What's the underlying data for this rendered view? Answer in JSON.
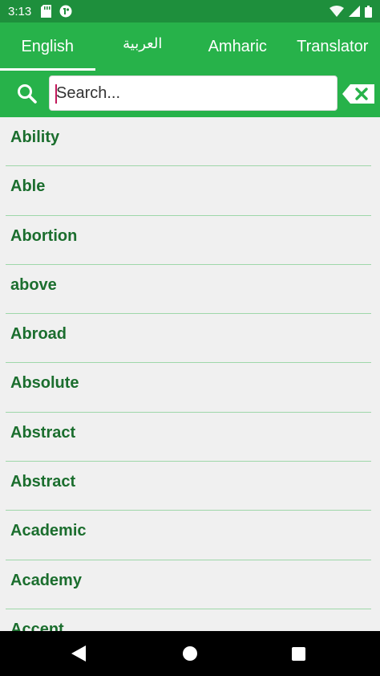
{
  "status_bar": {
    "time": "3:13",
    "left_icons": [
      "sd-card-icon",
      "app-notification-icon"
    ],
    "right_icons": [
      "wifi-icon",
      "signal-icon",
      "battery-icon"
    ]
  },
  "tabs": [
    {
      "label": "English",
      "selected": true
    },
    {
      "label": "العربية",
      "selected": false
    },
    {
      "label": "Amharic",
      "selected": false
    },
    {
      "label": "Translator",
      "selected": false
    }
  ],
  "search": {
    "placeholder": "Search...",
    "value": ""
  },
  "words": [
    "Ability",
    "Able",
    "Abortion",
    "above",
    "Abroad",
    "Absolute",
    "Abstract",
    "Abstract",
    "Academic",
    "Academy",
    "Accent"
  ],
  "colors": {
    "status_bar": "#1e8f3c",
    "primary": "#27b24a",
    "word_text": "#1b6e2e",
    "divider": "#9ed7a9",
    "list_background": "#f0f0f0"
  },
  "nav_bar": {
    "buttons": [
      "back-icon",
      "home-icon",
      "recents-icon"
    ]
  }
}
